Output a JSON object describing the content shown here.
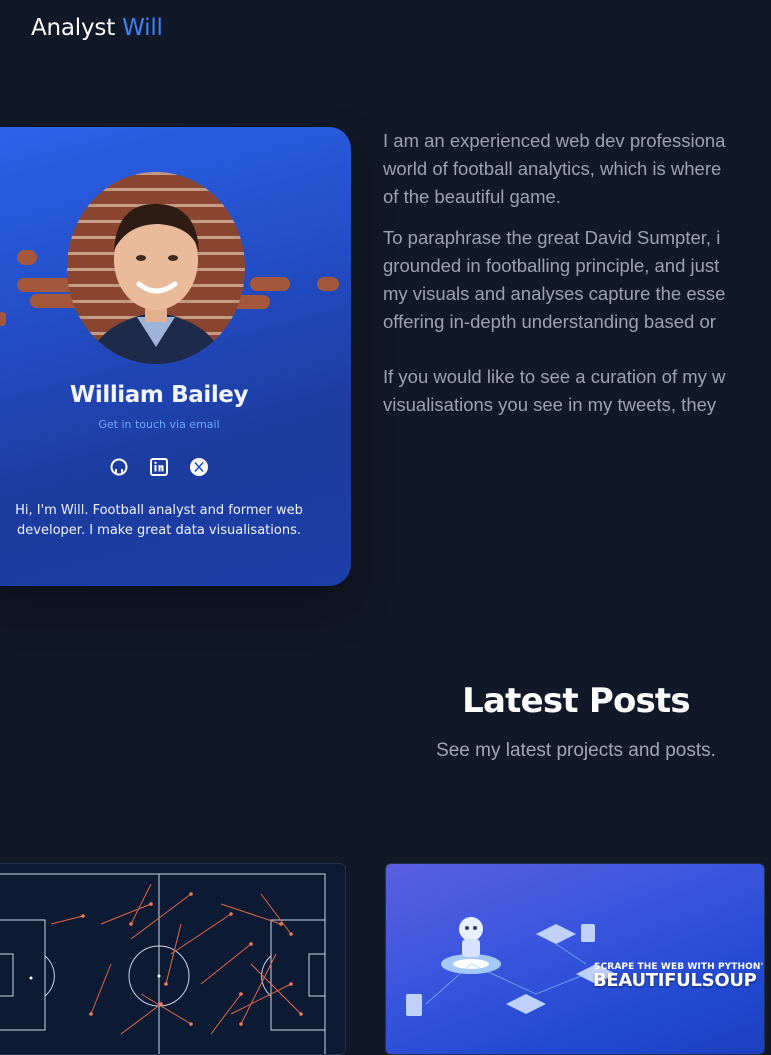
{
  "header": {
    "brand_first": "Analyst",
    "brand_second": "Will"
  },
  "profile": {
    "name": "William Bailey",
    "contact_link": "Get in touch via email",
    "socials": [
      {
        "icon": "github-icon"
      },
      {
        "icon": "linkedin-icon"
      },
      {
        "icon": "x-icon"
      }
    ],
    "bio": "Hi, I'm Will. Football analyst and former web developer. I make great data visualisations."
  },
  "about": {
    "p1_lines": [
      "I am an experienced web dev professiona",
      "world of football analytics, which is where",
      "of the beautiful game."
    ],
    "p2_lines": [
      "To paraphrase the great David Sumpter, i",
      "grounded in footballing principle, and just",
      "my visuals and analyses capture the esse",
      "offering in-depth understanding based or"
    ],
    "p3_lines": [
      "If you would like to see a curation of my w",
      "visualisations you see in my tweets, they"
    ]
  },
  "latest": {
    "title": "Latest Posts",
    "subtitle": "See my latest projects and posts."
  },
  "posts": [
    {
      "image": "football-pitch-pass-map"
    },
    {
      "image": "web-scraping-illustration",
      "overlay_small": "SCRAPE THE WEB WITH PYTHON'S",
      "overlay_big": "BEAUTIFULSOUP"
    }
  ],
  "colors": {
    "background": "#111827",
    "accent": "#3b82f6",
    "card": "#244fc9"
  }
}
